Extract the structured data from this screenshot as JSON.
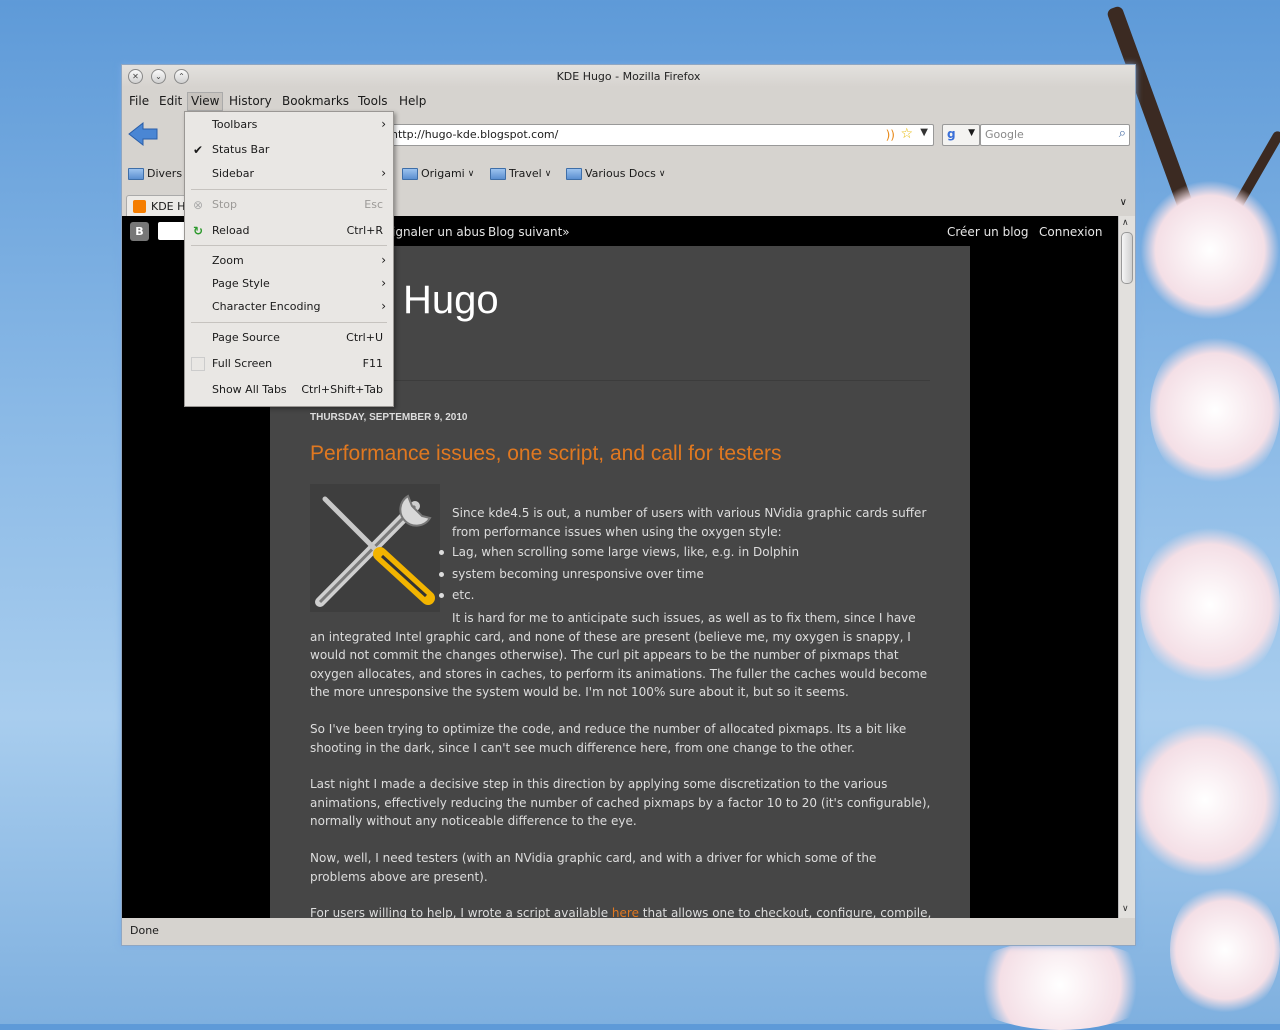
{
  "window": {
    "title": "KDE Hugo - Mozilla Firefox"
  },
  "menubar": [
    "File",
    "Edit",
    "View",
    "History",
    "Bookmarks",
    "Tools",
    "Help"
  ],
  "url": "http://hugo-kde.blogspot.com/",
  "search_placeholder": "Google",
  "bookmarks": [
    "Divers",
    "Origami",
    "Travel",
    "Various Docs"
  ],
  "tab": {
    "label": "KDE H"
  },
  "blogger_nav": {
    "report": "ignaler un abus",
    "next_blog": "Blog suivant»",
    "create_blog": "Créer un blog",
    "login": "Connexion"
  },
  "blog": {
    "title_visible": "Hugo",
    "date": "THURSDAY, SEPTEMBER 9, 2010",
    "post_title": "Performance issues, one script, and call for testers",
    "intro": "Since kde4.5 is out, a number of users with various NVidia graphic cards suffer from performance issues when using the oxygen style:",
    "bullets": [
      "Lag, when scrolling some large views, like, e.g. in Dolphin",
      "system becoming unresponsive over time",
      "etc."
    ],
    "paragraphs": [
      "It is hard for me to anticipate such issues, as well as to fix them, since I have an integrated Intel graphic card, and none of these are present (believe me, my oxygen is snappy, I would not commit the changes otherwise). The curl pit appears to be the number of pixmaps that oxygen allocates, and stores in caches, to perform its animations. The fuller the caches would become the more unresponsive the system would be. I'm not 100% sure about it, but so it seems.",
      "So I've been trying to optimize the code, and reduce the number of allocated pixmaps. Its a bit like shooting in the dark, since I can't see much difference here, from one change to the other.",
      "Last night I made a decisive step in this direction by applying some discretization to the various animations, effectively reducing the number of cached pixmaps by a factor 10 to 20 (it's configurable), normally without any noticeable difference to the eye.",
      "Now, well, I need testers (with an NVidia graphic card, and with a driver for which some of the problems above are present)."
    ],
    "last_para_start": "For users willing to help, I wrote a script available ",
    "last_para_link": "here",
    "last_para_end": " that allows one to checkout, configure, compile, and"
  },
  "view_menu": {
    "toolbars": "Toolbars",
    "status_bar": "Status Bar",
    "sidebar": "Sidebar",
    "stop": "Stop",
    "stop_sc": "Esc",
    "reload": "Reload",
    "reload_sc": "Ctrl+R",
    "zoom": "Zoom",
    "page_style": "Page Style",
    "char_enc": "Character Encoding",
    "page_source": "Page Source",
    "page_source_sc": "Ctrl+U",
    "full_screen": "Full Screen",
    "full_screen_sc": "F11",
    "show_all_tabs": "Show All Tabs",
    "show_all_tabs_sc": "Ctrl+Shift+Tab"
  },
  "status": "Done"
}
